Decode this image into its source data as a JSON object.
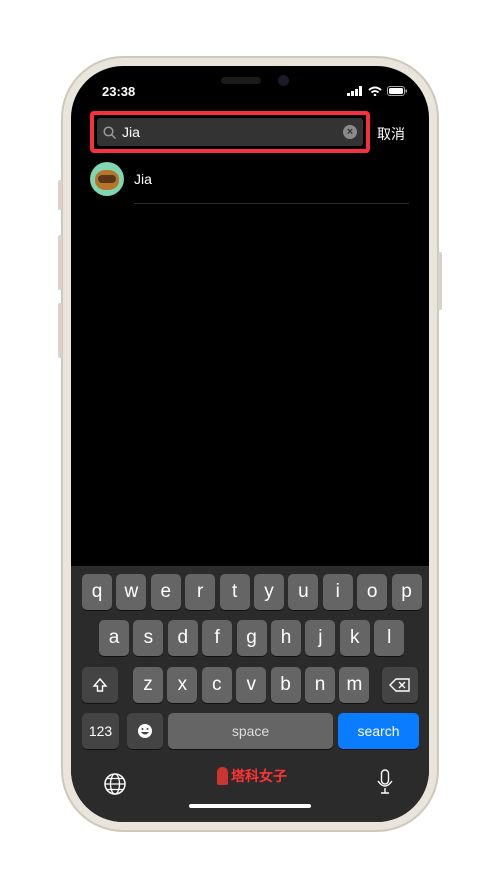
{
  "status": {
    "time": "23:38"
  },
  "search": {
    "query": "Jia",
    "cancel": "取消",
    "highlight_color": "#f7303f"
  },
  "results": [
    {
      "name": "Jia"
    }
  ],
  "keyboard": {
    "row1": [
      "q",
      "w",
      "e",
      "r",
      "t",
      "y",
      "u",
      "i",
      "o",
      "p"
    ],
    "row2": [
      "a",
      "s",
      "d",
      "f",
      "g",
      "h",
      "j",
      "k",
      "l"
    ],
    "row3": [
      "z",
      "x",
      "c",
      "v",
      "b",
      "n",
      "m"
    ],
    "numbers": "123",
    "space": "space",
    "search": "search",
    "accent": "#0a7cff"
  },
  "watermark": "塔科女子"
}
